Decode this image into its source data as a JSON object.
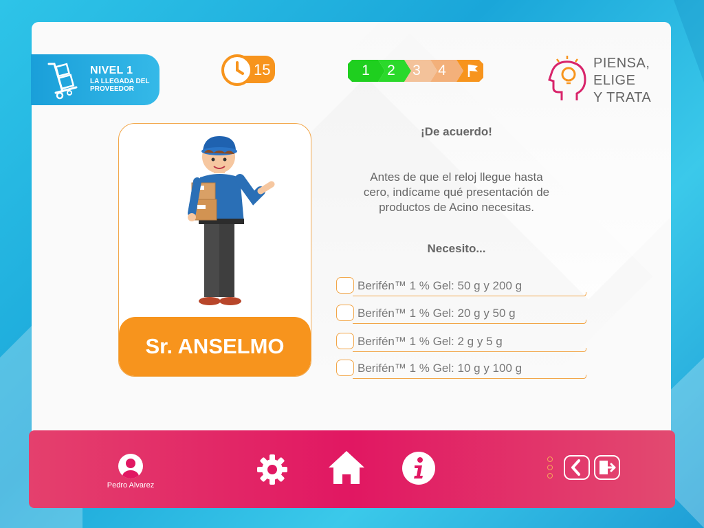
{
  "level": {
    "title": "NIVEL 1",
    "subtitle": "LA LLEGADA DEL PROVEEDOR",
    "icon": "hand-truck-icon"
  },
  "timer": {
    "value": "15",
    "icon": "clock-icon"
  },
  "progress": {
    "steps": [
      "1",
      "2",
      "3",
      "4"
    ],
    "completed": 2,
    "end_icon": "flag-icon"
  },
  "logo": {
    "lines": [
      "PIENSA,",
      "ELIGE",
      "Y TRATA"
    ],
    "icon": "head-lightbulb-icon"
  },
  "character": {
    "name": "Sr. ANSELMO"
  },
  "dialog": {
    "greeting": "¡De acuerdo!",
    "prompt": "Antes de que el reloj llegue hasta cero, indícame qué presentación de productos de Acino necesitas.",
    "need": "Necesito..."
  },
  "options": [
    {
      "label": "Berifén™ 1 % Gel: 50 g y 200 g",
      "checked": false
    },
    {
      "label": "Berifén™ 1 % Gel: 20 g y 50 g",
      "checked": false
    },
    {
      "label": "Berifén™ 1 % Gel: 2 g y 5 g",
      "checked": false
    },
    {
      "label": "Berifén™ 1 % Gel: 10 g y 100 g",
      "checked": false
    }
  ],
  "footer": {
    "user_name": "Pedro Alvarez",
    "buttons": [
      "gear-icon",
      "home-icon",
      "info-icon",
      "back-icon",
      "exit-icon"
    ]
  },
  "colors": {
    "accent_orange": "#f7941d",
    "accent_blue": "#1a9fd9",
    "accent_pink": "#e11762",
    "step_done": "#1fcf1f",
    "step_pending": "#f3b07a"
  }
}
